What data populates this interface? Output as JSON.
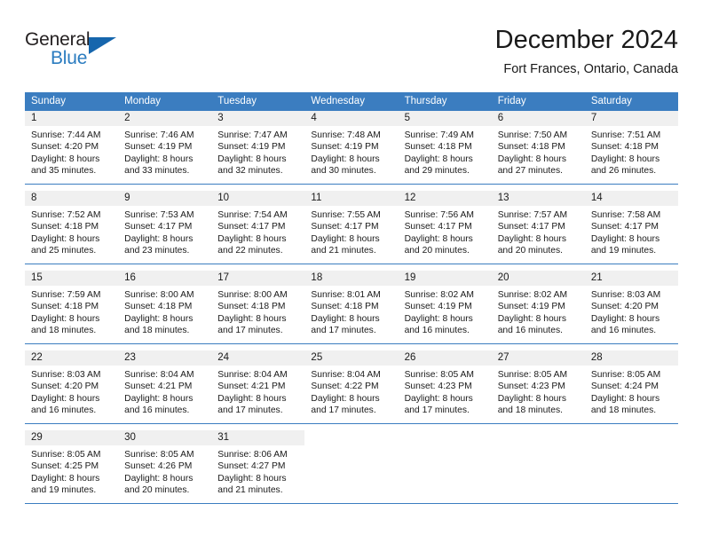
{
  "brand": {
    "name_part1": "General",
    "name_part2": "Blue",
    "accent_color": "#1666ad",
    "text_color": "#231f20",
    "blue_text_color": "#2b7cc0"
  },
  "header": {
    "title": "December 2024",
    "subtitle": "Fort Frances, Ontario, Canada"
  },
  "theme": {
    "header_row_bg": "#3b7dc0",
    "header_row_text": "#ffffff",
    "daynum_band_bg": "#f0f0f0",
    "week_divider": "#3b7dc0",
    "cell_bg": "#ffffff",
    "body_text": "#1a1a1a"
  },
  "weekday_headers": [
    "Sunday",
    "Monday",
    "Tuesday",
    "Wednesday",
    "Thursday",
    "Friday",
    "Saturday"
  ],
  "weeks": [
    [
      {
        "day": "1",
        "lines": [
          "Sunrise: 7:44 AM",
          "Sunset: 4:20 PM",
          "Daylight: 8 hours",
          "and 35 minutes."
        ]
      },
      {
        "day": "2",
        "lines": [
          "Sunrise: 7:46 AM",
          "Sunset: 4:19 PM",
          "Daylight: 8 hours",
          "and 33 minutes."
        ]
      },
      {
        "day": "3",
        "lines": [
          "Sunrise: 7:47 AM",
          "Sunset: 4:19 PM",
          "Daylight: 8 hours",
          "and 32 minutes."
        ]
      },
      {
        "day": "4",
        "lines": [
          "Sunrise: 7:48 AM",
          "Sunset: 4:19 PM",
          "Daylight: 8 hours",
          "and 30 minutes."
        ]
      },
      {
        "day": "5",
        "lines": [
          "Sunrise: 7:49 AM",
          "Sunset: 4:18 PM",
          "Daylight: 8 hours",
          "and 29 minutes."
        ]
      },
      {
        "day": "6",
        "lines": [
          "Sunrise: 7:50 AM",
          "Sunset: 4:18 PM",
          "Daylight: 8 hours",
          "and 27 minutes."
        ]
      },
      {
        "day": "7",
        "lines": [
          "Sunrise: 7:51 AM",
          "Sunset: 4:18 PM",
          "Daylight: 8 hours",
          "and 26 minutes."
        ]
      }
    ],
    [
      {
        "day": "8",
        "lines": [
          "Sunrise: 7:52 AM",
          "Sunset: 4:18 PM",
          "Daylight: 8 hours",
          "and 25 minutes."
        ]
      },
      {
        "day": "9",
        "lines": [
          "Sunrise: 7:53 AM",
          "Sunset: 4:17 PM",
          "Daylight: 8 hours",
          "and 23 minutes."
        ]
      },
      {
        "day": "10",
        "lines": [
          "Sunrise: 7:54 AM",
          "Sunset: 4:17 PM",
          "Daylight: 8 hours",
          "and 22 minutes."
        ]
      },
      {
        "day": "11",
        "lines": [
          "Sunrise: 7:55 AM",
          "Sunset: 4:17 PM",
          "Daylight: 8 hours",
          "and 21 minutes."
        ]
      },
      {
        "day": "12",
        "lines": [
          "Sunrise: 7:56 AM",
          "Sunset: 4:17 PM",
          "Daylight: 8 hours",
          "and 20 minutes."
        ]
      },
      {
        "day": "13",
        "lines": [
          "Sunrise: 7:57 AM",
          "Sunset: 4:17 PM",
          "Daylight: 8 hours",
          "and 20 minutes."
        ]
      },
      {
        "day": "14",
        "lines": [
          "Sunrise: 7:58 AM",
          "Sunset: 4:17 PM",
          "Daylight: 8 hours",
          "and 19 minutes."
        ]
      }
    ],
    [
      {
        "day": "15",
        "lines": [
          "Sunrise: 7:59 AM",
          "Sunset: 4:18 PM",
          "Daylight: 8 hours",
          "and 18 minutes."
        ]
      },
      {
        "day": "16",
        "lines": [
          "Sunrise: 8:00 AM",
          "Sunset: 4:18 PM",
          "Daylight: 8 hours",
          "and 18 minutes."
        ]
      },
      {
        "day": "17",
        "lines": [
          "Sunrise: 8:00 AM",
          "Sunset: 4:18 PM",
          "Daylight: 8 hours",
          "and 17 minutes."
        ]
      },
      {
        "day": "18",
        "lines": [
          "Sunrise: 8:01 AM",
          "Sunset: 4:18 PM",
          "Daylight: 8 hours",
          "and 17 minutes."
        ]
      },
      {
        "day": "19",
        "lines": [
          "Sunrise: 8:02 AM",
          "Sunset: 4:19 PM",
          "Daylight: 8 hours",
          "and 16 minutes."
        ]
      },
      {
        "day": "20",
        "lines": [
          "Sunrise: 8:02 AM",
          "Sunset: 4:19 PM",
          "Daylight: 8 hours",
          "and 16 minutes."
        ]
      },
      {
        "day": "21",
        "lines": [
          "Sunrise: 8:03 AM",
          "Sunset: 4:20 PM",
          "Daylight: 8 hours",
          "and 16 minutes."
        ]
      }
    ],
    [
      {
        "day": "22",
        "lines": [
          "Sunrise: 8:03 AM",
          "Sunset: 4:20 PM",
          "Daylight: 8 hours",
          "and 16 minutes."
        ]
      },
      {
        "day": "23",
        "lines": [
          "Sunrise: 8:04 AM",
          "Sunset: 4:21 PM",
          "Daylight: 8 hours",
          "and 16 minutes."
        ]
      },
      {
        "day": "24",
        "lines": [
          "Sunrise: 8:04 AM",
          "Sunset: 4:21 PM",
          "Daylight: 8 hours",
          "and 17 minutes."
        ]
      },
      {
        "day": "25",
        "lines": [
          "Sunrise: 8:04 AM",
          "Sunset: 4:22 PM",
          "Daylight: 8 hours",
          "and 17 minutes."
        ]
      },
      {
        "day": "26",
        "lines": [
          "Sunrise: 8:05 AM",
          "Sunset: 4:23 PM",
          "Daylight: 8 hours",
          "and 17 minutes."
        ]
      },
      {
        "day": "27",
        "lines": [
          "Sunrise: 8:05 AM",
          "Sunset: 4:23 PM",
          "Daylight: 8 hours",
          "and 18 minutes."
        ]
      },
      {
        "day": "28",
        "lines": [
          "Sunrise: 8:05 AM",
          "Sunset: 4:24 PM",
          "Daylight: 8 hours",
          "and 18 minutes."
        ]
      }
    ],
    [
      {
        "day": "29",
        "lines": [
          "Sunrise: 8:05 AM",
          "Sunset: 4:25 PM",
          "Daylight: 8 hours",
          "and 19 minutes."
        ]
      },
      {
        "day": "30",
        "lines": [
          "Sunrise: 8:05 AM",
          "Sunset: 4:26 PM",
          "Daylight: 8 hours",
          "and 20 minutes."
        ]
      },
      {
        "day": "31",
        "lines": [
          "Sunrise: 8:06 AM",
          "Sunset: 4:27 PM",
          "Daylight: 8 hours",
          "and 21 minutes."
        ]
      },
      {
        "day": "",
        "lines": []
      },
      {
        "day": "",
        "lines": []
      },
      {
        "day": "",
        "lines": []
      },
      {
        "day": "",
        "lines": []
      }
    ]
  ]
}
